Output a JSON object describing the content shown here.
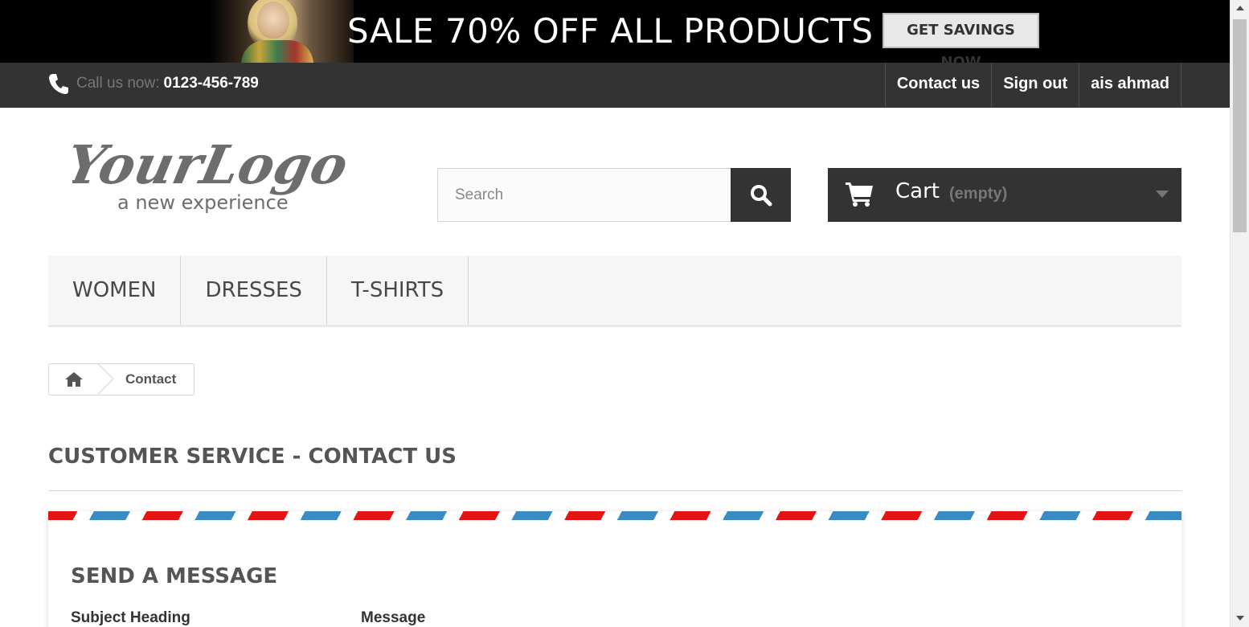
{
  "promo": {
    "headline": "SALE 70% OFF ALL PRODUCTS",
    "button_label": "GET SAVINGS NOW"
  },
  "topbar": {
    "call_label": "Call us now:",
    "phone_number": "0123-456-789",
    "links": [
      "Contact us",
      "Sign out",
      "ais ahmad"
    ]
  },
  "header": {
    "logo_main": "YourLogo",
    "logo_tagline": "a new experience",
    "search_placeholder": "Search",
    "cart_label": "Cart",
    "cart_status": "(empty)"
  },
  "menu": {
    "items": [
      "WOMEN",
      "DRESSES",
      "T-SHIRTS"
    ]
  },
  "breadcrumb": {
    "current": "Contact"
  },
  "page": {
    "title": "CUSTOMER SERVICE - CONTACT US",
    "form_title": "SEND A MESSAGE",
    "subject_label": "Subject Heading",
    "message_label": "Message"
  },
  "icons": {
    "phone": "phone-icon",
    "search": "search-icon",
    "cart": "cart-icon",
    "home": "home-icon",
    "dropdown": "caret-down-icon"
  },
  "colors": {
    "dark_bar": "#333333",
    "airmail_blue": "#3b8bc3",
    "airmail_red": "#e51414"
  }
}
